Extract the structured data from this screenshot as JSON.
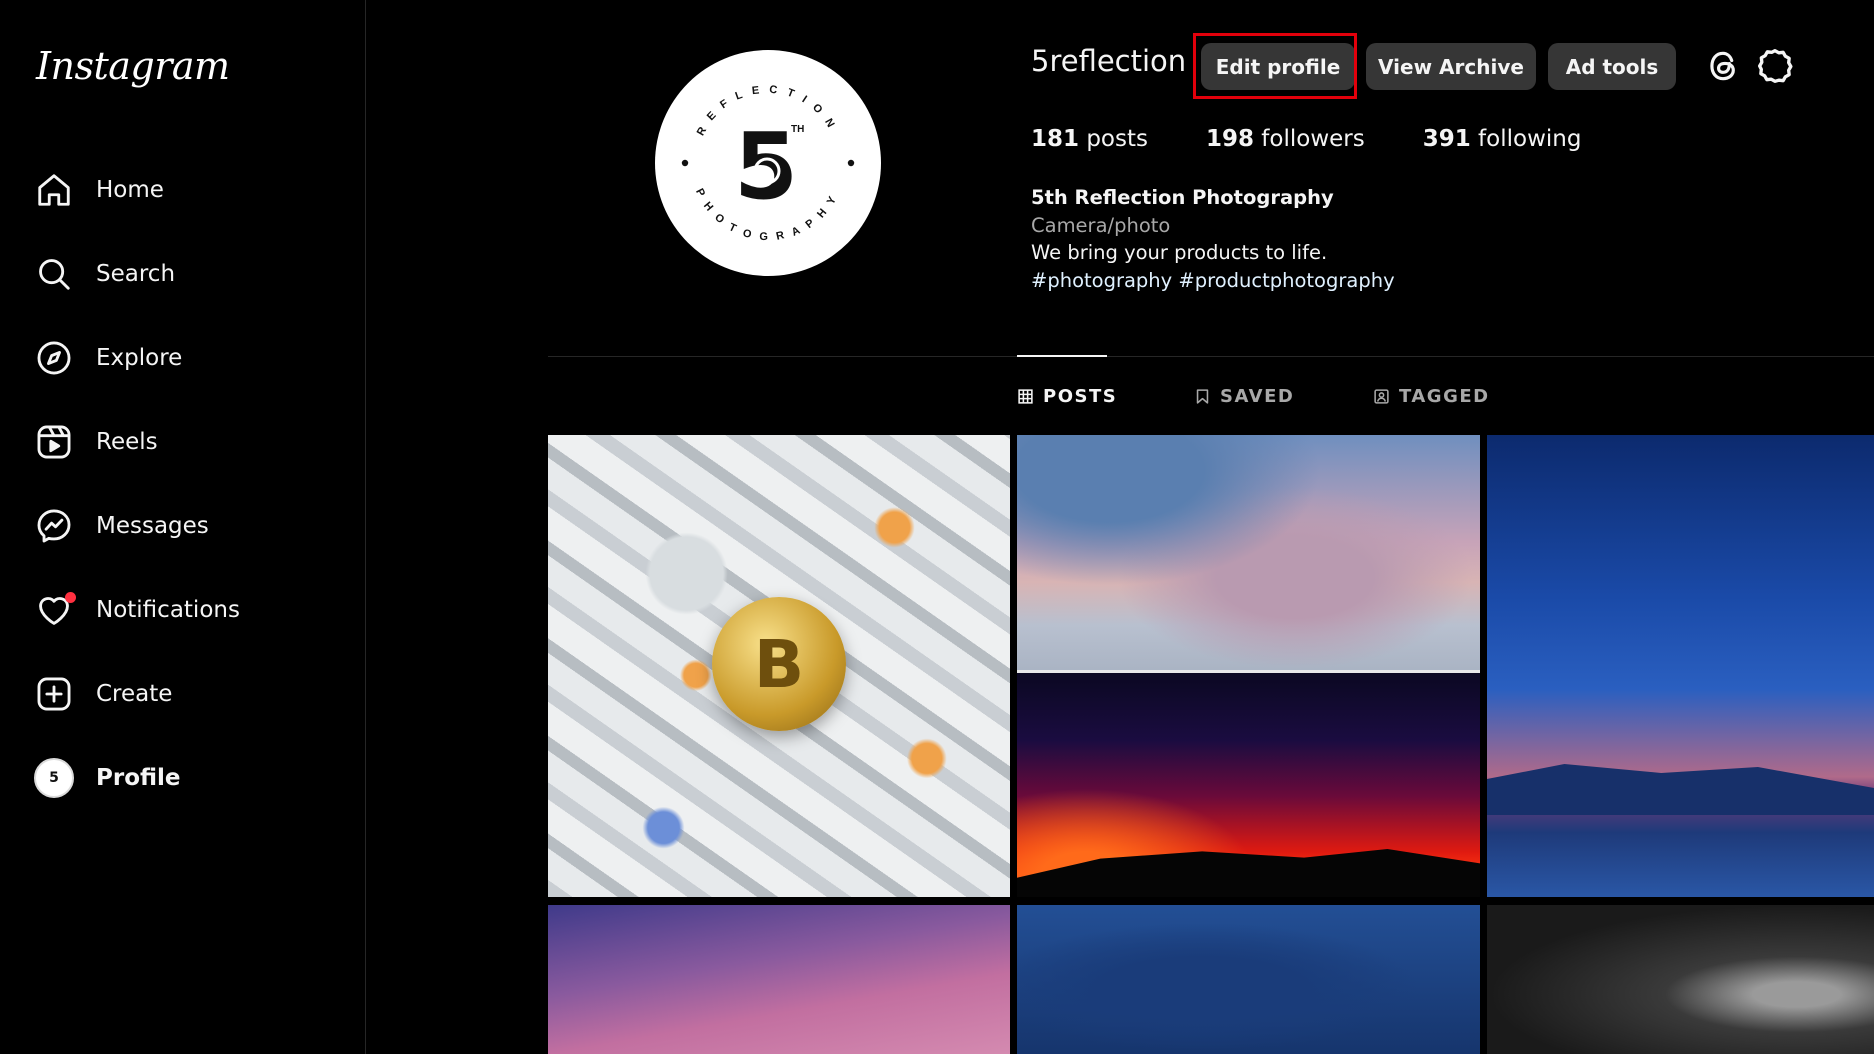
{
  "app": {
    "logo": "Instagram"
  },
  "sidebar": {
    "items": [
      {
        "label": "Home",
        "icon": "home-icon"
      },
      {
        "label": "Search",
        "icon": "search-icon"
      },
      {
        "label": "Explore",
        "icon": "compass-icon"
      },
      {
        "label": "Reels",
        "icon": "reels-icon"
      },
      {
        "label": "Messages",
        "icon": "messenger-icon"
      },
      {
        "label": "Notifications",
        "icon": "heart-icon",
        "has_badge": true
      },
      {
        "label": "Create",
        "icon": "plus-square-icon"
      },
      {
        "label": "Profile",
        "icon": "profile-avatar",
        "active": true
      }
    ]
  },
  "profile": {
    "username": "5reflection",
    "avatar_mark": "5",
    "avatar_ring_top": "REFLECTION",
    "avatar_ring_bottom": "PHOTOGRAPHY",
    "avatar_superscript": "TH",
    "buttons": {
      "edit": "Edit profile",
      "archive": "View Archive",
      "adtools": "Ad tools"
    },
    "stats": {
      "posts_count": "181",
      "posts_label": " posts",
      "followers_count": "198",
      "followers_label": " followers",
      "following_count": "391",
      "following_label": " following"
    },
    "bio": {
      "name": "5th Reflection Photography",
      "category": "Camera/photo",
      "text": "We bring your products to life.",
      "tags": "#photography #productphotography"
    }
  },
  "tabs": [
    {
      "label": "POSTS",
      "icon": "grid-icon",
      "active": true
    },
    {
      "label": "SAVED",
      "icon": "bookmark-icon",
      "active": false
    },
    {
      "label": "TAGGED",
      "icon": "tag-person-icon",
      "active": false
    }
  ],
  "posts": [
    {
      "subject": "bitcoin-on-dollar-bills",
      "coin_symbol": "B"
    },
    {
      "subject": "pastel-cloudy-sky-sea"
    },
    {
      "subject": "red-sunset-silhouette"
    },
    {
      "subject": "blue-dusk-mountains"
    },
    {
      "subject": "pink-purple-sky"
    },
    {
      "subject": "blue-shadow"
    },
    {
      "subject": "black-white-portrait"
    }
  ],
  "colors": {
    "background": "#000000",
    "button": "#363636",
    "highlight_box": "#e3000b",
    "notification_dot": "#ff3040",
    "muted_text": "#a8a8a8"
  }
}
